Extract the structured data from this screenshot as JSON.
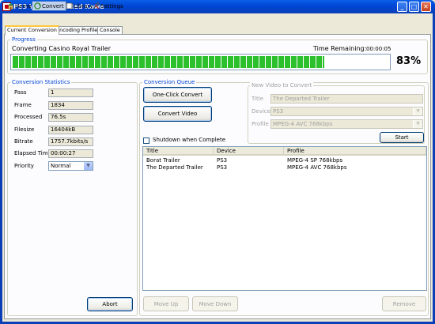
{
  "window": {
    "title": "PS3 Video 9 by Red Kawa",
    "minimize": "_",
    "maximize": "□",
    "close": "✕"
  },
  "toolbar": {
    "home": "Home",
    "convert": "Convert",
    "library": "Library",
    "settings": "Settings"
  },
  "tabs": [
    "Current Conversion",
    "Encoding Profiles",
    "Console"
  ],
  "progress": {
    "group_label": "Progress",
    "status_text": "Converting Casino Royal Trailer",
    "time_remaining_label": "Time Remaining:",
    "time_remaining_value": "00:00:05",
    "percent_text": "83%",
    "fraction": 0.83
  },
  "stats": {
    "group_label": "Conversion Statistics",
    "rows": [
      {
        "label": "Pass",
        "value": "1"
      },
      {
        "label": "Frame",
        "value": "1834"
      },
      {
        "label": "Processed",
        "value": "76.5s"
      },
      {
        "label": "Filesize",
        "value": "16404kB"
      },
      {
        "label": "Bitrate",
        "value": "1757.7kbits/s"
      },
      {
        "label": "Elapsed Time",
        "value": "00:00:27"
      }
    ],
    "priority_label": "Priority",
    "priority_value": "Normal",
    "abort_label": "Abort"
  },
  "queue": {
    "group_label": "Conversion Queue",
    "one_click_label": "One-Click Convert",
    "convert_video_label": "Convert Video",
    "shutdown_label": "Shutdown when Complete",
    "shutdown_checked": false,
    "columns": [
      "Title",
      "Device",
      "Profile"
    ],
    "rows": [
      {
        "title": "Borat Trailer",
        "device": "PS3",
        "profile": "MPEG-4 SP 768kbps"
      },
      {
        "title": "The Departed Trailer",
        "device": "PS3",
        "profile": "MPEG-4 AVC 768kbps"
      }
    ],
    "move_up_label": "Move Up",
    "move_down_label": "Move Down",
    "remove_label": "Remove"
  },
  "new_video": {
    "group_label": "New Video to Convert",
    "title_label": "Title",
    "title_value": "The Departed Trailer",
    "device_label": "Device",
    "device_value": "PS3",
    "profile_label": "Profile",
    "profile_value": "MPEG-4 AVC 768kbps",
    "start_label": "Start"
  },
  "colors": {
    "titlebar": "#0046D5",
    "progress_fill": "#2CC02C",
    "group_label": "#0046D5",
    "window_bg": "#ECE9D8"
  }
}
